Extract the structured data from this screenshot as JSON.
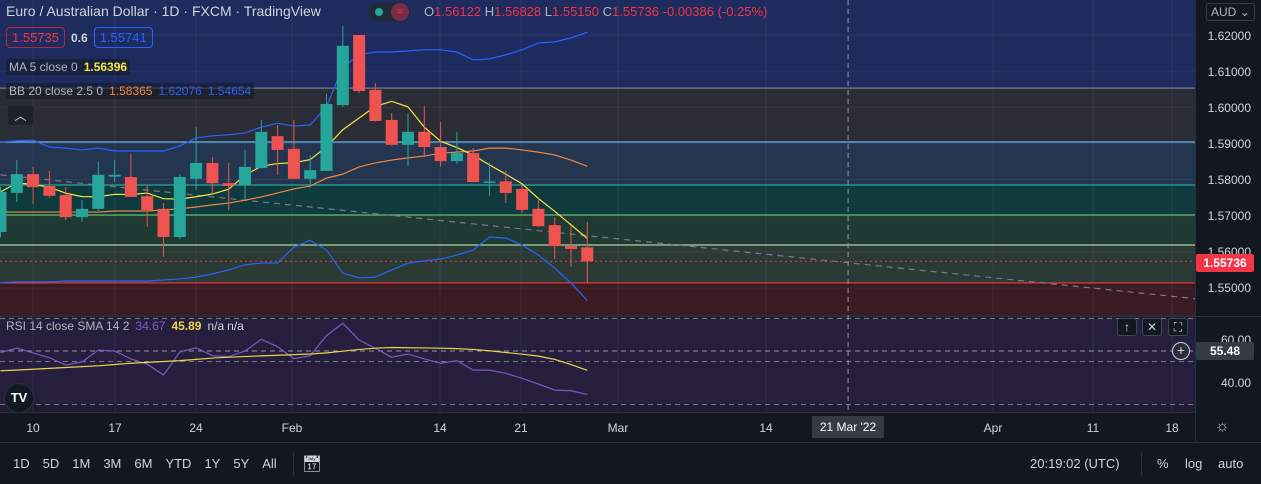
{
  "header": {
    "title": "Euro / Australian Dollar · 1D · FXCM · TradingView",
    "ohlc": {
      "o_label": "O",
      "o": "1.56122",
      "h_label": "H",
      "h": "1.56828",
      "l_label": "L",
      "l": "1.55150",
      "c_label": "C",
      "c": "1.55736",
      "change": "-0.00386 (-0.25%)"
    },
    "sell_price": "1.55735",
    "spread": "0.6",
    "buy_price": "1.55741"
  },
  "indicators": {
    "ma": {
      "label": "MA 5 close 0",
      "value": "1.56396",
      "color": "#f5e642"
    },
    "bb": {
      "label": "BB 20 close 2.5 0",
      "basis": "1.58365",
      "upper": "1.62076",
      "lower": "1.54654",
      "basis_color": "#f0883e",
      "band_color": "#2962ff"
    },
    "rsi": {
      "label": "RSI 14 close SMA 14 2",
      "value": "34.67",
      "sma": "45.89",
      "na1": "n/a",
      "na2": "n/a",
      "color": "#7e57c2",
      "sma_color": "#e8d44d"
    }
  },
  "price_axis": {
    "currency": "AUD",
    "ticks": [
      "1.62000",
      "1.61000",
      "1.60000",
      "1.59000",
      "1.58000",
      "1.57000",
      "1.56000",
      "1.55000"
    ],
    "last_price": "1.55736",
    "rsi_ticks": [
      "60.00",
      "40.00"
    ],
    "rsi_cursor": "55.48"
  },
  "time_axis": {
    "labels": [
      "10",
      "17",
      "24",
      "Feb",
      "14",
      "21",
      "Mar",
      "14",
      "21 Mar '22",
      "Apr",
      "11",
      "18"
    ]
  },
  "bottom": {
    "ranges": [
      "1D",
      "5D",
      "1M",
      "3M",
      "6M",
      "YTD",
      "1Y",
      "5Y",
      "All"
    ],
    "clock": "20:19:02 (UTC)",
    "pct": "%",
    "log": "log",
    "auto": "auto"
  },
  "colors": {
    "up": "#26a69a",
    "down": "#ef5350",
    "background": "#131722"
  },
  "chart_data": {
    "type": "candlestick",
    "symbol": "EURAUD",
    "interval": "1D",
    "ylim": [
      1.545,
      1.625
    ],
    "columns": [
      "date",
      "open",
      "high",
      "low",
      "close"
    ],
    "candles": [
      [
        "2022-01-06",
        1.5655,
        1.578,
        1.564,
        1.5766
      ],
      [
        "2022-01-07",
        1.5763,
        1.5854,
        1.5738,
        1.5815
      ],
      [
        "2022-01-10",
        1.5815,
        1.5835,
        1.5732,
        1.5779
      ],
      [
        "2022-01-11",
        1.5782,
        1.5824,
        1.575,
        1.5755
      ],
      [
        "2022-01-12",
        1.5757,
        1.5779,
        1.5688,
        1.5696
      ],
      [
        "2022-01-13",
        1.5696,
        1.5743,
        1.5683,
        1.5719
      ],
      [
        "2022-01-14",
        1.5719,
        1.5849,
        1.5713,
        1.5813
      ],
      [
        "2022-01-17",
        1.5808,
        1.5854,
        1.5793,
        1.5813
      ],
      [
        "2022-01-18",
        1.5807,
        1.5871,
        1.5752,
        1.5752
      ],
      [
        "2022-01-19",
        1.5754,
        1.5785,
        1.5669,
        1.5716
      ],
      [
        "2022-01-20",
        1.5719,
        1.5735,
        1.5586,
        1.5641
      ],
      [
        "2022-01-21",
        1.5641,
        1.5815,
        1.5635,
        1.5807
      ],
      [
        "2022-01-24",
        1.5802,
        1.5945,
        1.5771,
        1.5846
      ],
      [
        "2022-01-25",
        1.5846,
        1.5862,
        1.5757,
        1.579
      ],
      [
        "2022-01-26",
        1.579,
        1.5846,
        1.5716,
        1.5782
      ],
      [
        "2022-01-27",
        1.5785,
        1.5882,
        1.5743,
        1.5835
      ],
      [
        "2022-01-28",
        1.5832,
        1.5965,
        1.583,
        1.5932
      ],
      [
        "2022-01-31",
        1.592,
        1.5951,
        1.5813,
        1.5882
      ],
      [
        "2022-02-01",
        1.5885,
        1.5965,
        1.5802,
        1.5802
      ],
      [
        "2022-02-02",
        1.5802,
        1.5867,
        1.5777,
        1.5826
      ],
      [
        "2022-02-03",
        1.5824,
        1.6037,
        1.5824,
        1.6009
      ],
      [
        "2022-02-04",
        1.6006,
        1.6225,
        1.6001,
        1.617
      ],
      [
        "2022-02-07",
        1.62,
        1.62,
        1.604,
        1.6045
      ],
      [
        "2022-02-08",
        1.6048,
        1.6067,
        1.596,
        1.5962
      ],
      [
        "2022-02-09",
        1.5965,
        1.5984,
        1.5893,
        1.5896
      ],
      [
        "2022-02-10",
        1.5896,
        1.5984,
        1.5838,
        1.5932
      ],
      [
        "2022-02-11",
        1.5932,
        1.6003,
        1.5862,
        1.589
      ],
      [
        "2022-02-14",
        1.589,
        1.5959,
        1.5835,
        1.5851
      ],
      [
        "2022-02-15",
        1.5851,
        1.5932,
        1.5843,
        1.5873
      ],
      [
        "2022-02-16",
        1.5873,
        1.5887,
        1.5793,
        1.5793
      ],
      [
        "2022-02-17",
        1.5792,
        1.5846,
        1.5755,
        1.5795
      ],
      [
        "2022-02-18",
        1.5795,
        1.5824,
        1.5735,
        1.5763
      ],
      [
        "2022-02-21",
        1.5774,
        1.5785,
        1.5707,
        1.5716
      ],
      [
        "2022-02-22",
        1.5719,
        1.5749,
        1.5669,
        1.5671
      ],
      [
        "2022-02-23",
        1.5674,
        1.5696,
        1.558,
        1.5616
      ],
      [
        "2022-02-24",
        1.5616,
        1.5674,
        1.5558,
        1.5608
      ],
      [
        "2022-02-25",
        1.56122,
        1.56828,
        1.5515,
        1.55736
      ]
    ],
    "bb_upper": [
      1.5904,
      1.5907,
      1.5909,
      1.589,
      1.5887,
      1.5882,
      1.5887,
      1.5879,
      1.5879,
      1.5879,
      1.5879,
      1.5893,
      1.5915,
      1.5921,
      1.5924,
      1.5929,
      1.5945,
      1.5956,
      1.5948,
      1.5951,
      1.6001,
      1.6111,
      1.6145,
      1.6153,
      1.6153,
      1.6156,
      1.6159,
      1.6159,
      1.6153,
      1.6131,
      1.6134,
      1.6145,
      1.6159,
      1.6178,
      1.6181,
      1.6192,
      1.62076
    ],
    "bb_basis": [
      1.571,
      1.571,
      1.571,
      1.571,
      1.571,
      1.571,
      1.571,
      1.5713,
      1.5713,
      1.5713,
      1.5716,
      1.5719,
      1.5724,
      1.573,
      1.5735,
      1.5743,
      1.5752,
      1.5763,
      1.5774,
      1.5782,
      1.5804,
      1.5815,
      1.5835,
      1.5846,
      1.5854,
      1.586,
      1.5865,
      1.5873,
      1.5876,
      1.5879,
      1.5887,
      1.5887,
      1.5882,
      1.5876,
      1.5868,
      1.5854,
      1.58365
    ],
    "bb_lower": [
      1.5514,
      1.5517,
      1.5517,
      1.5517,
      1.5519,
      1.5519,
      1.5519,
      1.5519,
      1.5519,
      1.5519,
      1.5522,
      1.5525,
      1.553,
      1.5539,
      1.555,
      1.5564,
      1.5569,
      1.5569,
      1.5613,
      1.5632,
      1.5605,
      1.5541,
      1.5528,
      1.553,
      1.555,
      1.5569,
      1.5575,
      1.558,
      1.5591,
      1.5605,
      1.5641,
      1.5638,
      1.5619,
      1.5591,
      1.5555,
      1.5514,
      1.54654
    ],
    "rsi": [
      54.1,
      56.2,
      54.0,
      51.8,
      48.4,
      49.8,
      55.3,
      54.9,
      51.2,
      48.8,
      43.7,
      54.4,
      56.4,
      52.7,
      52.2,
      54.9,
      60.3,
      56.9,
      51.3,
      52.7,
      62.0,
      67.8,
      60.0,
      56.1,
      52.0,
      53.5,
      51.2,
      49.2,
      50.4,
      46.0,
      46.0,
      44.5,
      42.2,
      39.5,
      36.7,
      36.4,
      34.67
    ],
    "rsi_sma": [
      45.7,
      46.0,
      46.4,
      46.8,
      47.2,
      47.6,
      48.0,
      48.6,
      49.2,
      49.6,
      50.0,
      50.4,
      51.0,
      51.6,
      52.0,
      52.3,
      52.6,
      52.9,
      53.2,
      53.5,
      54.0,
      54.8,
      55.6,
      56.2,
      56.5,
      56.4,
      56.3,
      56.2,
      56.0,
      55.6,
      55.0,
      54.2,
      53.4,
      52.5,
      51.0,
      48.6,
      45.89
    ],
    "rsi_levels": [
      70,
      50,
      30
    ],
    "fib_levels": [
      {
        "price": 1.6053,
        "color": "#787b86",
        "fill": "#1e2b5e"
      },
      {
        "price": 1.5904,
        "color": "#64b5f6",
        "fill": "#2a2d36"
      },
      {
        "price": 1.5785,
        "color": "#26a69a",
        "fill": "#243550"
      },
      {
        "price": 1.5702,
        "color": "#66bb6a",
        "fill": "#0f3a3e"
      },
      {
        "price": 1.5619,
        "color": "#a5d6a7",
        "fill": "#1f3a33"
      },
      {
        "price": 1.5514,
        "color": "#f23645",
        "fill": "#2b3a35",
        "below_fill": "#3a1b22"
      }
    ],
    "trendline": {
      "start": {
        "date": "2022-01-06",
        "price": 1.5813
      },
      "end": {
        "date": "2022-04-25",
        "price": 1.5453
      }
    },
    "crosshair_date": "2022-03-21"
  }
}
